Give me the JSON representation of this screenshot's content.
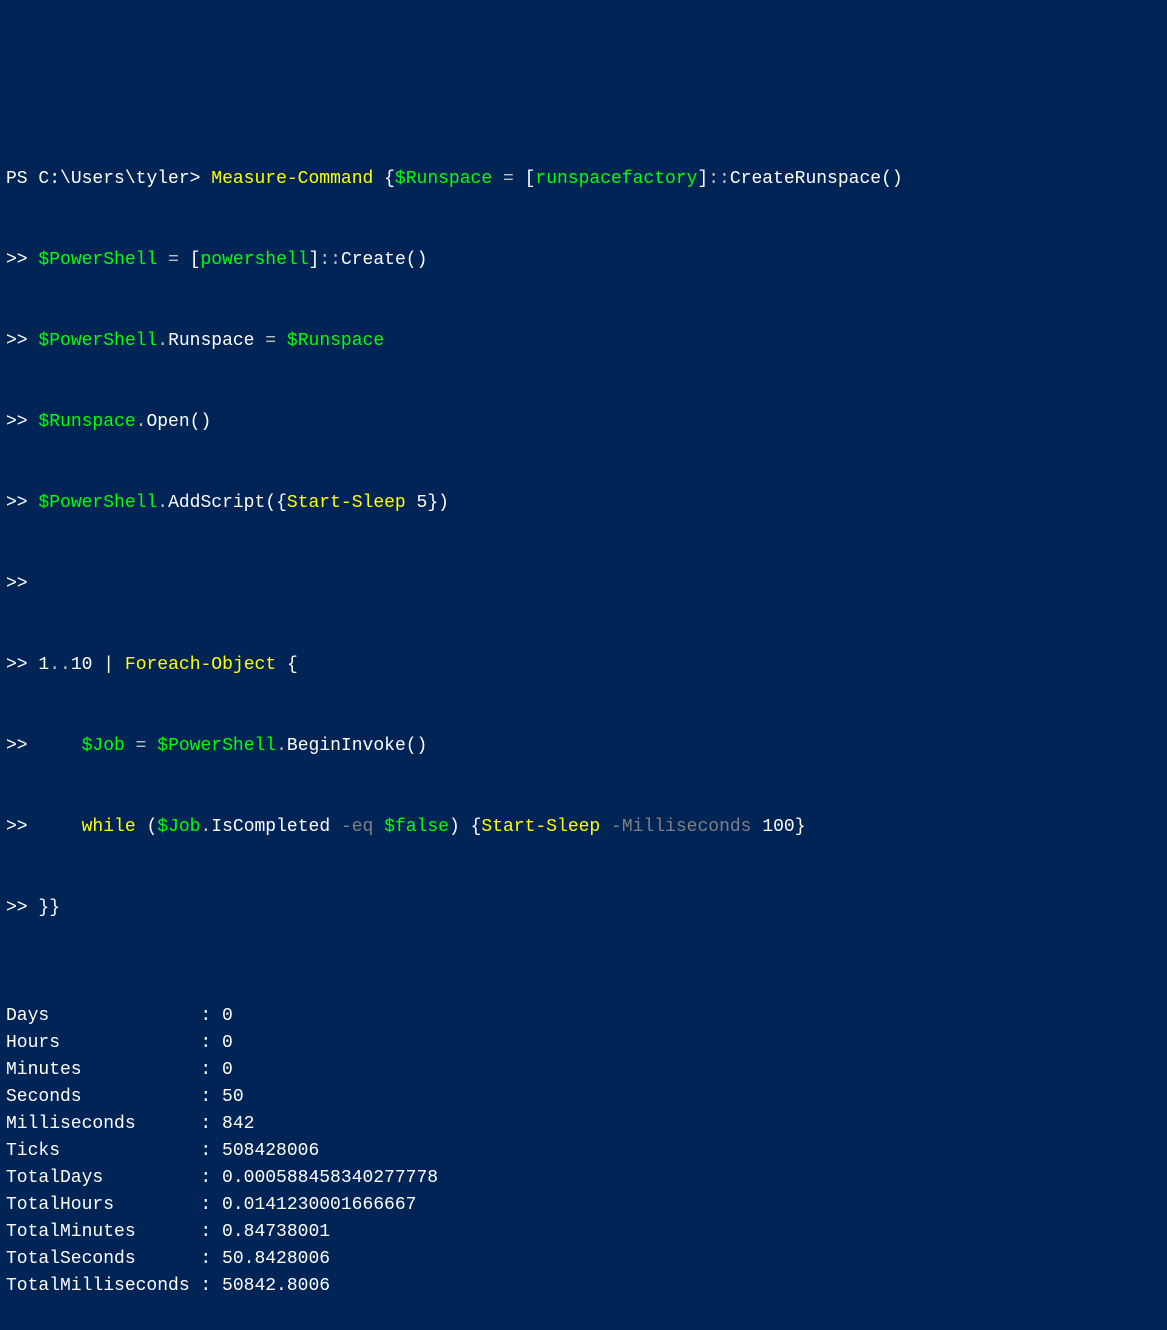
{
  "prompt": {
    "ps": "PS",
    "path": "C:\\Users\\tyler>"
  },
  "continuation": ">>",
  "tokens": {
    "measureCommand": "Measure-Command",
    "braceOpen": "{",
    "braceClose": "}",
    "runspaceVar": "$Runspace",
    "powershellVar": "$PowerShell",
    "jobVar": "$Job",
    "eq": "=",
    "runspaceFactory": "runspacefactory",
    "powershellType": "powershell",
    "createRunspace": "CreateRunspace",
    "create": "Create",
    "runspaceProp": "Runspace",
    "open": "Open",
    "addScript": "AddScript",
    "startSleep": "Start-Sleep",
    "five": "5",
    "one": "1",
    "dots": "..",
    "ten": "10",
    "pipe": "|",
    "foreachObject": "Foreach-Object",
    "beginInvoke": "BeginInvoke",
    "while": "while",
    "isCompleted": "IsCompleted",
    "eqOp": "-eq",
    "false": "$false",
    "milliseconds": "-Milliseconds",
    "hundred": "100",
    "lbr": "[",
    "rbr": "]",
    "dcolon": "::",
    "paren": "()",
    "lparen": "(",
    "rparen": ")",
    "dot": "."
  },
  "results": [
    {
      "label": "Days",
      "value": "0"
    },
    {
      "label": "Hours",
      "value": "0"
    },
    {
      "label": "Minutes",
      "value": "0"
    },
    {
      "label": "Seconds",
      "value": "50"
    },
    {
      "label": "Milliseconds",
      "value": "842"
    },
    {
      "label": "Ticks",
      "value": "508428006"
    },
    {
      "label": "TotalDays",
      "value": "0.000588458340277778"
    },
    {
      "label": "TotalHours",
      "value": "0.0141230001666667"
    },
    {
      "label": "TotalMinutes",
      "value": "0.84738001"
    },
    {
      "label": "TotalSeconds",
      "value": "50.8428006"
    },
    {
      "label": "TotalMilliseconds",
      "value": "50842.8006"
    }
  ],
  "labelWidth": 17
}
